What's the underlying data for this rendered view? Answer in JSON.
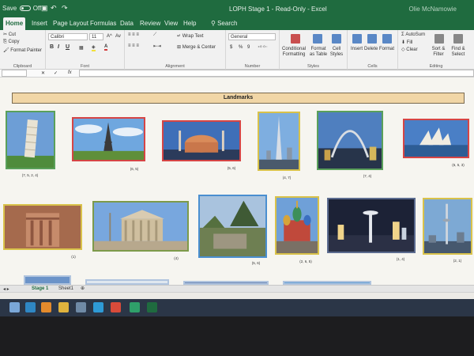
{
  "window": {
    "autosave_label": "Save",
    "autosave_state": "Off",
    "title": "LOPH Stage 1 - Read-Only - Excel",
    "user": "Olie McNamowie"
  },
  "ribbon": {
    "tabs": [
      "Home",
      "Insert",
      "Page Layout",
      "Formulas",
      "Data",
      "Review",
      "View",
      "Help",
      "Search"
    ],
    "active_tab": "Home",
    "clipboard": {
      "cut": "Cut",
      "copy": "Copy",
      "painter": "Format Painter",
      "label": "Clipboard"
    },
    "font": {
      "name": "Calibri",
      "size": "11",
      "grow": "A^",
      "shrink": "Av",
      "bold": "B",
      "italic": "I",
      "underline": "U",
      "label": "Font"
    },
    "alignment": {
      "wrap": "Wrap Text",
      "merge": "Merge & Center",
      "label": "Alignment"
    },
    "number": {
      "format": "General",
      "currency": "$",
      "percent": "%",
      "comma": "9",
      "label": "Number"
    },
    "styles": {
      "conditional": "Conditional Formatting",
      "table": "Format as Table",
      "cell": "Cell Styles",
      "label": "Styles"
    },
    "cells": {
      "insert": "Insert",
      "delete": "Delete",
      "format": "Format",
      "label": "Cells"
    },
    "editing": {
      "autosum": "AutoSum",
      "fill": "Fill",
      "clear": "Clear",
      "sort": "Sort & Filter",
      "find": "Find & Select",
      "label": "Editing"
    }
  },
  "formula_bar": {
    "fx": "fx",
    "cancel": "✕",
    "enter": "✓"
  },
  "sheet": {
    "banner": "Landmarks",
    "row1": [
      {
        "name": "leaning-tower-pisa",
        "caption": "(7, 5, 2, 4)"
      },
      {
        "name": "eiffel-tower",
        "caption": "(6, 5)"
      },
      {
        "name": "hagia-sophia",
        "caption": "(5, 6)"
      },
      {
        "name": "burj-khalifa",
        "caption": "(4, 7)"
      },
      {
        "name": "gateway-arch",
        "caption": "(7, 4)"
      },
      {
        "name": "sydney-opera-house",
        "caption": "(6, 5, 3)"
      }
    ],
    "row2": [
      {
        "name": "petra",
        "caption": "(1)"
      },
      {
        "name": "pantheon",
        "caption": "(4)"
      },
      {
        "name": "machu-picchu",
        "caption": "(5, 6)"
      },
      {
        "name": "st-basils-cathedral",
        "caption": "(2, 6, 5)"
      },
      {
        "name": "space-needle",
        "caption": "(1, 4)"
      },
      {
        "name": "cn-tower",
        "caption": "(2, 1)"
      }
    ]
  },
  "sheet_tabs": [
    "Stage 1",
    "Sheet1"
  ],
  "taskbar": {
    "icons": [
      "start-icon",
      "search-icon",
      "excel-icon",
      "folder-icon",
      "mail-icon",
      "edge-icon",
      "chrome-icon",
      "teams-icon",
      "excel-icon"
    ]
  },
  "colors": {
    "excel_green": "#1f6b3f",
    "banner_fill": "#f1d6a6"
  }
}
